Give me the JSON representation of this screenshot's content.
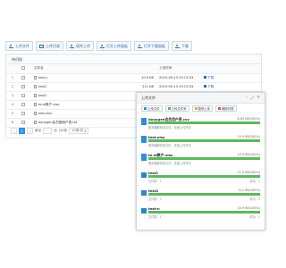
{
  "toolbar": {
    "upload_file": "上传文件",
    "upload_folder": "上传目录",
    "slice_upload": "续传上传",
    "open_upload_panel": "打开上传面板",
    "open_download_panel": "打开下载面板",
    "download": "下载"
  },
  "panel": {
    "title": "待归档"
  },
  "table": {
    "columns": [
      "",
      "",
      "文件名",
      "",
      "上传时间",
      ""
    ],
    "rows": [
      {
        "idx": "1",
        "name": "test-n",
        "size": "10.9 KB",
        "date": "2019-09-13 15:13:53",
        "action": "下载"
      },
      {
        "idx": "2",
        "name": "test2",
        "size": "211 KB",
        "date": "2019-09-13 15:13:53",
        "action": "下载"
      },
      {
        "idx": "3",
        "name": "test1",
        "size": "",
        "date": "",
        "action": ""
      },
      {
        "idx": "4",
        "name": "te.st数户.xlsx",
        "size": "",
        "date": "",
        "action": ""
      },
      {
        "idx": "5",
        "name": "test.xlsx",
        "size": "",
        "date": "",
        "action": ""
      },
      {
        "idx": "6",
        "name": "douygen会员图用户表.txt",
        "size": "",
        "date": "",
        "action": ""
      }
    ]
  },
  "pager": {
    "current": "1",
    "goto_label": "跳至",
    "page_unit": "页",
    "total": "共6条",
    "page_size": "10条/页"
  },
  "dialog": {
    "title": "上传文件",
    "buttons": {
      "upload_file": "上传文件",
      "upload_folder": "上传文件夹",
      "pause_upload": "暂停上传",
      "clear_list": "删除列表"
    },
    "files": [
      {
        "name": "douygen会员用户表.csv",
        "size": "6.63 KB(100%)",
        "progress": 100,
        "status": "服务器解析用文件，快速上传完毕",
        "type": "file"
      },
      {
        "name": "test.xlsx",
        "size": "10.9 KB(100%)",
        "progress": 100,
        "status": "服务器解析用文件，快速上传完毕",
        "type": "file"
      },
      {
        "name": "te.st数户.xlsx",
        "size": "10.9 KB(100%)",
        "progress": 100,
        "status": "服务器解析用文件，快速上传完毕",
        "type": "file"
      },
      {
        "name": "test1",
        "size": "21.2 KB(100%)",
        "progress": 100,
        "status": "文件数：1",
        "status_r": "成功：1",
        "type": "folder"
      },
      {
        "name": "test2",
        "size": "211 KB(100%)",
        "progress": 100,
        "status": "文件数：3",
        "status_r": "成功：3",
        "type": "folder"
      },
      {
        "name": "test-n",
        "size": "10.9 KB(100%)",
        "progress": 100,
        "status": "文件数：1",
        "status_r": "成功：1",
        "type": "folder"
      }
    ]
  }
}
